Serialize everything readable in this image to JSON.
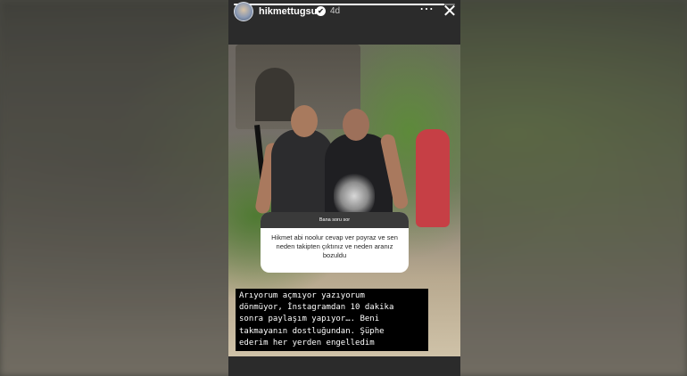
{
  "story": {
    "username": "hikmettugsuz",
    "verified_badge": "✔",
    "time_ago": "4d",
    "more_icon": "⋯",
    "close_icon": "✕",
    "progress": 0.95
  },
  "question_sticker": {
    "header": "Bana soru sor",
    "question": "Hikmet abi noolur cevap ver poyraz ve sen neden takipten çıktınız ve neden aranız bozuldu"
  },
  "caption": {
    "text": "Arıyorum açmıyor yazıyorum\ndönmüyor, İnstagramdan 10 dakika\nsonra paylaşım yapıyor…. Beni\ntakmayanın dostluğundan. Şüphe\nederim her yerden engelledim"
  },
  "colors": {
    "page_bg": "#5a5a52",
    "story_bg": "#2b2b2b",
    "sticker_header": "#3a3a3a",
    "caption_bg": "#000000",
    "text_white": "#ffffff"
  }
}
